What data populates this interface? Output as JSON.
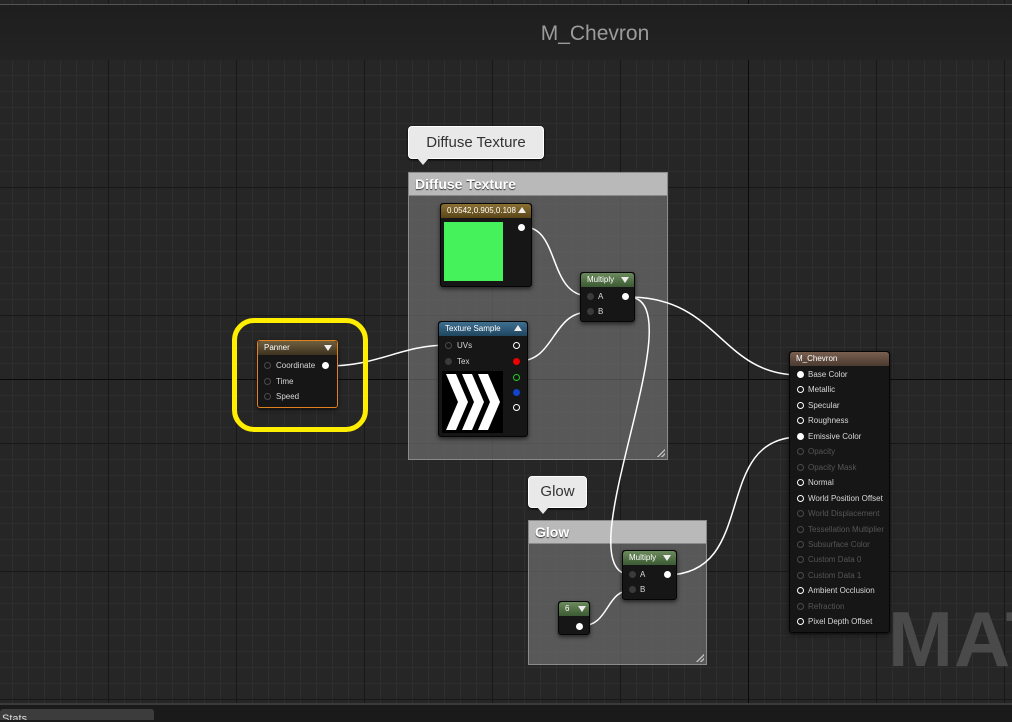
{
  "graph_title": "M_Chevron",
  "watermark": "MATERIAL",
  "bottom_tab": "Stats",
  "comments": {
    "diffuse": {
      "title": "Diffuse Texture",
      "bubble": "Diffuse Texture"
    },
    "glow": {
      "title": "Glow",
      "bubble": "Glow"
    }
  },
  "nodes": {
    "constant3": {
      "title": "0.0542,0.905,0.108",
      "preview_color": "#45f25c"
    },
    "texture_sample": {
      "title": "Texture Sample",
      "inputs": [
        "UVs",
        "Tex"
      ]
    },
    "multiply_top": {
      "title": "Multiply",
      "inputs": [
        "A",
        "B"
      ]
    },
    "panner": {
      "title": "Panner",
      "inputs": [
        "Coordinate",
        "Time",
        "Speed"
      ]
    },
    "multiply_glow": {
      "title": "Multiply",
      "inputs": [
        "A",
        "B"
      ]
    },
    "constant_glow": {
      "title": "6"
    },
    "root": {
      "title": "M_Chevron",
      "inputs": [
        {
          "label": "Base Color",
          "active": true
        },
        {
          "label": "Metallic",
          "active": true
        },
        {
          "label": "Specular",
          "active": true
        },
        {
          "label": "Roughness",
          "active": true
        },
        {
          "label": "Emissive Color",
          "active": true
        },
        {
          "label": "Opacity",
          "active": false
        },
        {
          "label": "Opacity Mask",
          "active": false
        },
        {
          "label": "Normal",
          "active": true
        },
        {
          "label": "World Position Offset",
          "active": true
        },
        {
          "label": "World Displacement",
          "active": false
        },
        {
          "label": "Tessellation Multiplier",
          "active": false
        },
        {
          "label": "Subsurface Color",
          "active": false
        },
        {
          "label": "Custom Data 0",
          "active": false
        },
        {
          "label": "Custom Data 1",
          "active": false
        },
        {
          "label": "Ambient Occlusion",
          "active": true
        },
        {
          "label": "Refraction",
          "active": false
        },
        {
          "label": "Pixel Depth Offset",
          "active": true
        }
      ]
    }
  },
  "colors": {
    "selection": "#ffee00",
    "wire": "#ffffff",
    "background": "#262626"
  }
}
